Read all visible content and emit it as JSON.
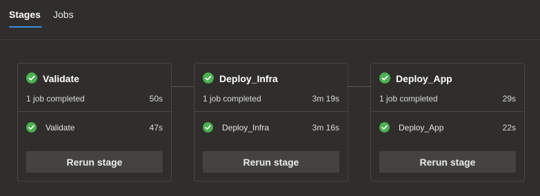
{
  "tabs": [
    {
      "label": "Stages",
      "active": true
    },
    {
      "label": "Jobs",
      "active": false
    }
  ],
  "colors": {
    "success": "#4caf50",
    "tab_accent": "#3b8fe3"
  },
  "stages": [
    {
      "title": "Validate",
      "status": "succeeded",
      "status_icon": "check-circle-icon",
      "summary": "1 job completed",
      "duration": "50s",
      "jobs": [
        {
          "name": "Validate",
          "duration": "47s",
          "status_icon": "check-circle-icon"
        }
      ],
      "rerun_label": "Rerun stage"
    },
    {
      "title": "Deploy_Infra",
      "status": "succeeded",
      "status_icon": "check-circle-icon",
      "summary": "1 job completed",
      "duration": "3m 19s",
      "jobs": [
        {
          "name": "Deploy_Infra",
          "duration": "3m 16s",
          "status_icon": "check-circle-icon"
        }
      ],
      "rerun_label": "Rerun stage"
    },
    {
      "title": "Deploy_App",
      "status": "succeeded",
      "status_icon": "check-circle-icon",
      "summary": "1 job completed",
      "duration": "29s",
      "jobs": [
        {
          "name": "Deploy_App",
          "duration": "22s",
          "status_icon": "check-circle-icon"
        }
      ],
      "rerun_label": "Rerun stage"
    }
  ]
}
